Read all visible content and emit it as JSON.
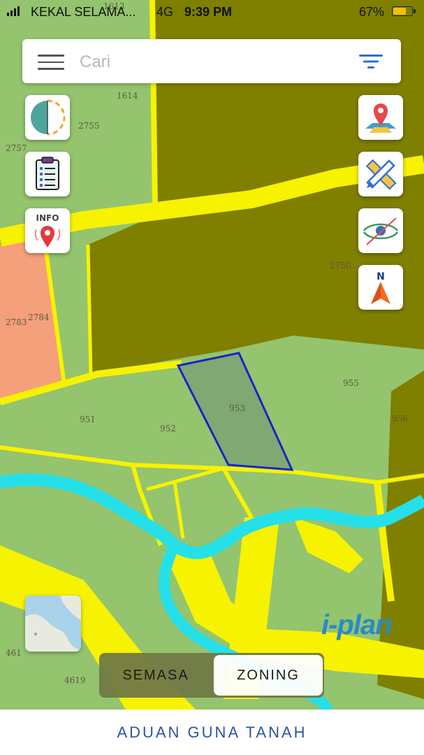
{
  "status_bar": {
    "carrier": "KEKAL SELAMA...",
    "network": "4G",
    "time": "9:39 PM",
    "battery": "67%"
  },
  "search": {
    "placeholder": "Cari",
    "value": ""
  },
  "map": {
    "parcel_labels": [
      "1613",
      "1614",
      "2755",
      "2757",
      "2750",
      "2783",
      "2784",
      "951",
      "952",
      "953",
      "955",
      "956",
      "4619",
      "461"
    ],
    "selected_parcel": "953"
  },
  "left_buttons": [
    "layer-toggle",
    "report-list",
    "info-location"
  ],
  "info_label": "INFO",
  "right_buttons": [
    "map-marker",
    "measure-tool",
    "visibility-toggle",
    "compass"
  ],
  "compass_label": "N",
  "logo": "i-plan",
  "toggle": {
    "semasa": "SEMASA",
    "zoning": "ZONING",
    "active": "zoning"
  },
  "bottom_link": "ADUAN GUNA TANAH"
}
